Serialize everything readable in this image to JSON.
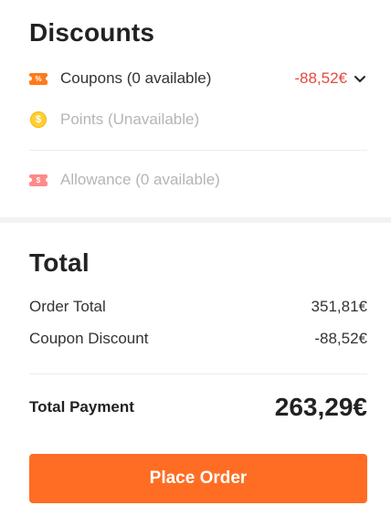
{
  "discounts": {
    "title": "Discounts",
    "coupons": {
      "label": "Coupons (0 available)",
      "amount": "-88,52€",
      "icon": "coupon-icon",
      "badge": "%"
    },
    "points": {
      "label": "Points (Unavailable)",
      "icon": "coin-icon",
      "badge": "$"
    },
    "allowance": {
      "label": "Allowance (0 available)",
      "icon": "allowance-icon",
      "badge": "$"
    }
  },
  "total": {
    "title": "Total",
    "order_total_label": "Order Total",
    "order_total_value": "351,81€",
    "coupon_discount_label": "Coupon Discount",
    "coupon_discount_value": "-88,52€",
    "payment_label": "Total Payment",
    "payment_value": "263,29€"
  },
  "place_order_label": "Place Order",
  "colors": {
    "accent": "#ff6d24",
    "discount_red": "#e8483b",
    "disabled_text": "#b5b5b5"
  }
}
